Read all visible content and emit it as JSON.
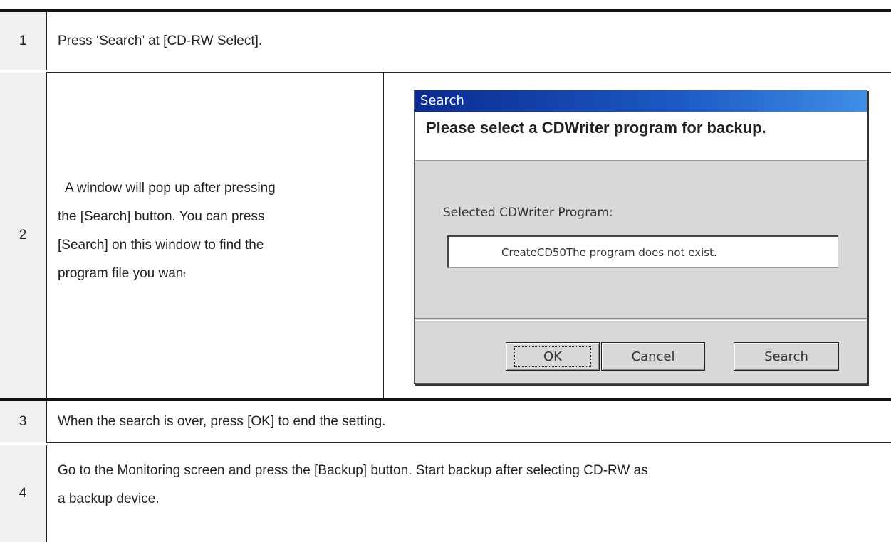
{
  "steps": [
    {
      "num": "1",
      "text": "Press ‘Search’ at [CD-RW Select]."
    },
    {
      "num": "2",
      "text": "A window will pop up after pressing the [Search] button. You can press [Search] on this window to find the program file you want."
    },
    {
      "num": "3",
      "text": "When the search is over, press [OK] to end the setting."
    },
    {
      "num": "4",
      "text": "Go to the Monitoring screen and press the [Backup] button. Start backup after selecting CD-RW as a backup device."
    }
  ],
  "step2_lines": [
    "A window will pop up after pressing",
    "the [Search] button. You can press",
    "[Search] on this window to find the",
    "program file you wan"
  ],
  "step2_tail": "t.",
  "step4_lines": [
    "Go to the Monitoring screen and press the [Backup] button. Start backup after selecting CD-RW as",
    "a backup device."
  ],
  "dialog": {
    "title": "Search",
    "heading": "Please select a CDWriter program for backup.",
    "selected_label": "Selected CDWriter Program:",
    "program_value": "CreateCD50The program does not exist.",
    "ok_label": "OK",
    "cancel_label": "Cancel",
    "search_label": "Search"
  },
  "colors": {
    "titlebar_start": "#0a2a8f",
    "titlebar_end": "#3f8ee6",
    "dialog_bg": "#d8d8d8"
  }
}
